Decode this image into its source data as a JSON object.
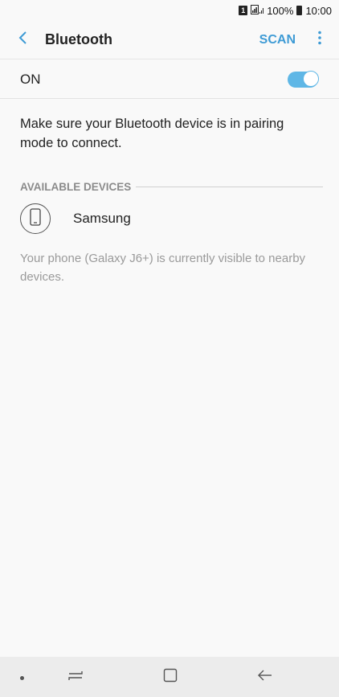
{
  "status_bar": {
    "sim_label": "1",
    "battery": "100%",
    "time": "10:00"
  },
  "app_bar": {
    "title": "Bluetooth",
    "scan_label": "SCAN",
    "back_icon": "chevron-left-icon",
    "more_icon": "more-vertical-icon"
  },
  "toggle_row": {
    "label": "ON",
    "state": "on"
  },
  "pairing_message": "Make sure your Bluetooth device is in pairing mode to connect.",
  "available_devices": {
    "header": "AVAILABLE DEVICES",
    "devices": [
      {
        "name": "Samsung",
        "icon": "phone-icon"
      }
    ]
  },
  "visibility_message": "Your phone (Galaxy J6+) is currently visible to nearby devices.",
  "colors": {
    "accent": "#3e9bd5",
    "toggle_on": "#5fb7e6",
    "background": "#f9f9f9",
    "nav_bar": "#ececec"
  },
  "nav_bar": {
    "icons": [
      "dot-icon",
      "recent-apps-icon",
      "home-icon",
      "back-arrow-icon"
    ]
  }
}
